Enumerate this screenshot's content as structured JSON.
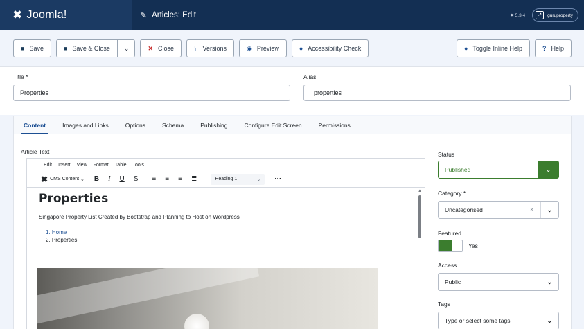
{
  "header": {
    "brand": "Joomla!",
    "page_title": "Articles: Edit",
    "version": "5.3.4",
    "user": "guruproperty"
  },
  "toolbar": {
    "save": "Save",
    "save_close": "Save & Close",
    "close": "Close",
    "versions": "Versions",
    "preview": "Preview",
    "accessibility": "Accessibility Check",
    "toggle_help": "Toggle Inline Help",
    "help": "Help"
  },
  "form": {
    "title_label": "Title *",
    "title_value": "Properties",
    "alias_label": "Alias",
    "alias_value": "properties"
  },
  "tabs": [
    "Content",
    "Images and Links",
    "Options",
    "Schema",
    "Publishing",
    "Configure Edit Screen",
    "Permissions"
  ],
  "editor": {
    "label": "Article Text",
    "menu": [
      "Edit",
      "Insert",
      "View",
      "Format",
      "Table",
      "Tools"
    ],
    "cms_content": "CMS Content",
    "heading_select": "Heading 1",
    "content": {
      "heading": "Properties",
      "paragraph": "Singapore Property List Created by Bootstrap and Planning to Host on Wordpress",
      "list": [
        "1. Home",
        "2. Properties"
      ]
    }
  },
  "sidebar": {
    "status_label": "Status",
    "status_value": "Published",
    "category_label": "Category *",
    "category_value": "Uncategorised",
    "featured_label": "Featured",
    "featured_value": "Yes",
    "access_label": "Access",
    "access_value": "Public",
    "tags_label": "Tags",
    "tags_placeholder": "Type or select some tags"
  },
  "colors": {
    "header_bg": "#132f53",
    "accent_blue": "#1c4f93",
    "status_green": "#3b7d2e",
    "close_red": "#c52827"
  }
}
